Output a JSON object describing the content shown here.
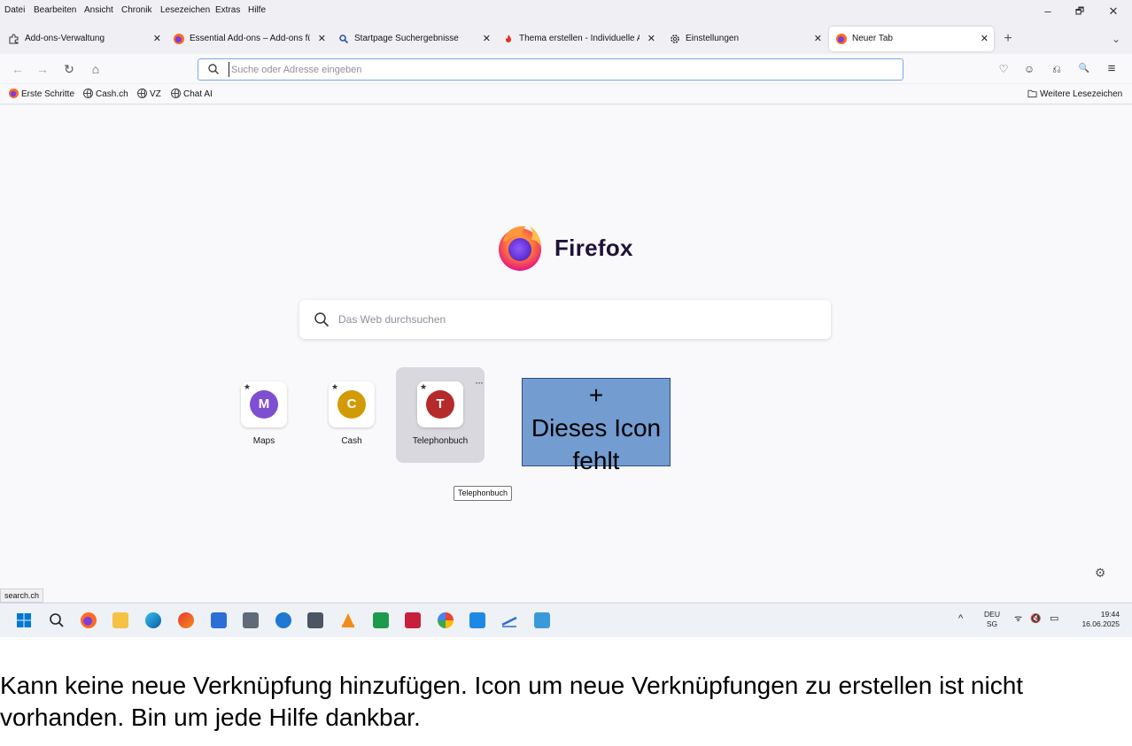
{
  "menubar": {
    "items": [
      "Datei",
      "Bearbeiten",
      "Ansicht",
      "Chronik",
      "Lesezeichen",
      "Extras",
      "Hilfe"
    ]
  },
  "window_controls": {
    "minimize": "–",
    "restore": "🗗",
    "close": "✕"
  },
  "tabs": [
    {
      "label": "Add-ons-Verwaltung",
      "icon": "puzzle-icon"
    },
    {
      "label": "Essential Add-ons – Add-ons fü",
      "icon": "firefox-icon"
    },
    {
      "label": "Startpage Suchergebnisse",
      "icon": "magnifier-icon"
    },
    {
      "label": "Thema erstellen - Individuelle A",
      "icon": "flame-icon"
    },
    {
      "label": "Einstellungen",
      "icon": "gear-icon"
    },
    {
      "label": "Neuer Tab",
      "icon": "firefox-icon",
      "active": true
    }
  ],
  "tab_close_glyph": "✕",
  "tab_new_glyph": "+",
  "tab_list_glyph": "⌄",
  "navbar": {
    "back": "←",
    "forward": "→",
    "reload": "↻",
    "home": "⌂",
    "url_placeholder": "Suche oder Adresse eingeben",
    "url_value": ""
  },
  "toolbar_icons": [
    "pocket-icon",
    "account-icon",
    "extensions-icon",
    "search-addon-icon",
    "menu-icon"
  ],
  "toolbar_glyphs": {
    "pocket": "♡",
    "account": "☺",
    "extensions": "⎌",
    "search_addon": "🔍",
    "menu": "≡"
  },
  "bookmarks": {
    "items": [
      {
        "label": "Erste Schritte",
        "icon": "firefox-icon"
      },
      {
        "label": "Cash.ch",
        "icon": "globe-icon"
      },
      {
        "label": "VZ",
        "icon": "globe-icon"
      },
      {
        "label": "Chat AI",
        "icon": "globe-icon"
      }
    ],
    "other": "Weitere Lesezeichen"
  },
  "newtab": {
    "brand": "Firefox",
    "search_placeholder": "Das Web durchsuchen",
    "shortcuts": [
      {
        "letter": "M",
        "label": "Maps",
        "color": "#7e4fd1"
      },
      {
        "letter": "C",
        "label": "Cash",
        "color": "#d29b06"
      },
      {
        "letter": "T",
        "label": "Telephonbuch",
        "color": "#b52a2a"
      }
    ],
    "more_glyph": "···",
    "pin_glyph": "★",
    "tooltip": "Telephonbuch",
    "gear_glyph": "⚙"
  },
  "annotation": {
    "plus": "+",
    "line1": "Dieses Icon",
    "line2": "fehlt",
    "fill": "#739cd0"
  },
  "status_text": "search.ch",
  "taskbar": {
    "language": "DEU",
    "layout": "SG",
    "time": "19:44",
    "date": "16.06.2025",
    "chevron": "^",
    "tray_glyphs": {
      "wifi": "ᯤ",
      "sound": "🔇",
      "battery": "▭"
    }
  },
  "caption": "Kann keine neue Verknüpfung hinzufügen. Icon um neue Verknüpfungen zu erstellen ist nicht vorhanden. Bin um jede Hilfe dankbar."
}
